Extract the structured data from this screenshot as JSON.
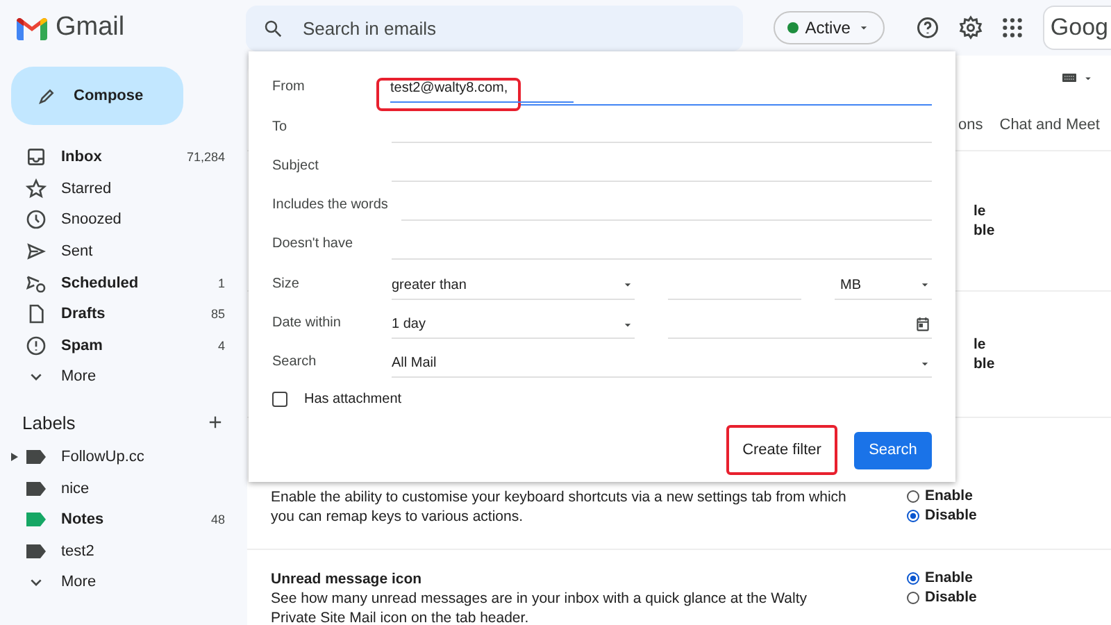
{
  "app": {
    "name": "Gmail"
  },
  "search": {
    "placeholder": "Search in emails"
  },
  "status": {
    "label": "Active",
    "color": "#1e8e3e"
  },
  "brand": "Goog",
  "compose": "Compose",
  "nav": [
    {
      "kind": "inbox",
      "label": "Inbox",
      "count": "71,284",
      "bold": true
    },
    {
      "kind": "star",
      "label": "Starred",
      "bold": false
    },
    {
      "kind": "snooze",
      "label": "Snoozed",
      "bold": false
    },
    {
      "kind": "sent",
      "label": "Sent",
      "bold": false
    },
    {
      "kind": "scheduled",
      "label": "Scheduled",
      "count": "1",
      "bold": true
    },
    {
      "kind": "drafts",
      "label": "Drafts",
      "count": "85",
      "bold": true
    },
    {
      "kind": "spam",
      "label": "Spam",
      "count": "4",
      "bold": true
    },
    {
      "kind": "more",
      "label": "More",
      "bold": false
    }
  ],
  "labels": {
    "title": "Labels",
    "items": [
      {
        "label": "FollowUp.cc",
        "color": "#444746",
        "bold": false,
        "has_children": true
      },
      {
        "label": "nice",
        "color": "#444746",
        "bold": false,
        "has_children": false
      },
      {
        "label": "Notes",
        "color": "#16a765",
        "bold": true,
        "count": "48",
        "has_children": false
      },
      {
        "label": "test2",
        "color": "#444746",
        "bold": false,
        "has_children": false
      }
    ],
    "more": "More"
  },
  "settings": {
    "tabs": [
      "ons",
      "Chat and Meet"
    ],
    "rows": [
      {
        "kind": "covered",
        "options": [
          {
            "label": "le"
          },
          {
            "label": "ble"
          }
        ]
      },
      {
        "kind": "covered",
        "options": [
          {
            "label": "le"
          },
          {
            "label": "ble"
          }
        ]
      },
      {
        "kind": "full",
        "description": "Enable the ability to customise your keyboard shortcuts via a new settings tab from which you can remap keys to various actions.",
        "options": [
          {
            "label": "Enable",
            "selected": false
          },
          {
            "label": "Disable",
            "selected": true
          }
        ]
      },
      {
        "kind": "full",
        "title": "Unread message icon",
        "description": "See how many unread messages are in your inbox with a quick glance at the Walty Private Site Mail icon on the tab header.",
        "options": [
          {
            "label": "Enable",
            "selected": true
          },
          {
            "label": "Disable",
            "selected": false
          }
        ]
      }
    ]
  },
  "filter": {
    "fields": [
      {
        "kind": "text",
        "label": "From",
        "value": "test2@walty8.com,",
        "focused": true,
        "highlighted": true
      },
      {
        "kind": "text",
        "label": "To",
        "focused": false,
        "highlighted": false
      },
      {
        "kind": "text",
        "label": "Subject",
        "focused": false,
        "highlighted": false
      },
      {
        "kind": "text",
        "label": "Includes the words",
        "focused": false,
        "highlighted": false
      },
      {
        "kind": "text",
        "label": "Doesn't have",
        "focused": false,
        "highlighted": false
      },
      {
        "kind": "size",
        "label": "Size",
        "operator": "greater than",
        "unit": "MB"
      },
      {
        "kind": "date",
        "label": "Date within",
        "value": "1 day"
      },
      {
        "kind": "select",
        "label": "Search",
        "value": "All Mail"
      }
    ],
    "has_attachment": {
      "label": "Has attachment",
      "checked": false
    },
    "create_filter": {
      "label": "Create filter",
      "highlighted": true
    },
    "search_button": "Search"
  }
}
